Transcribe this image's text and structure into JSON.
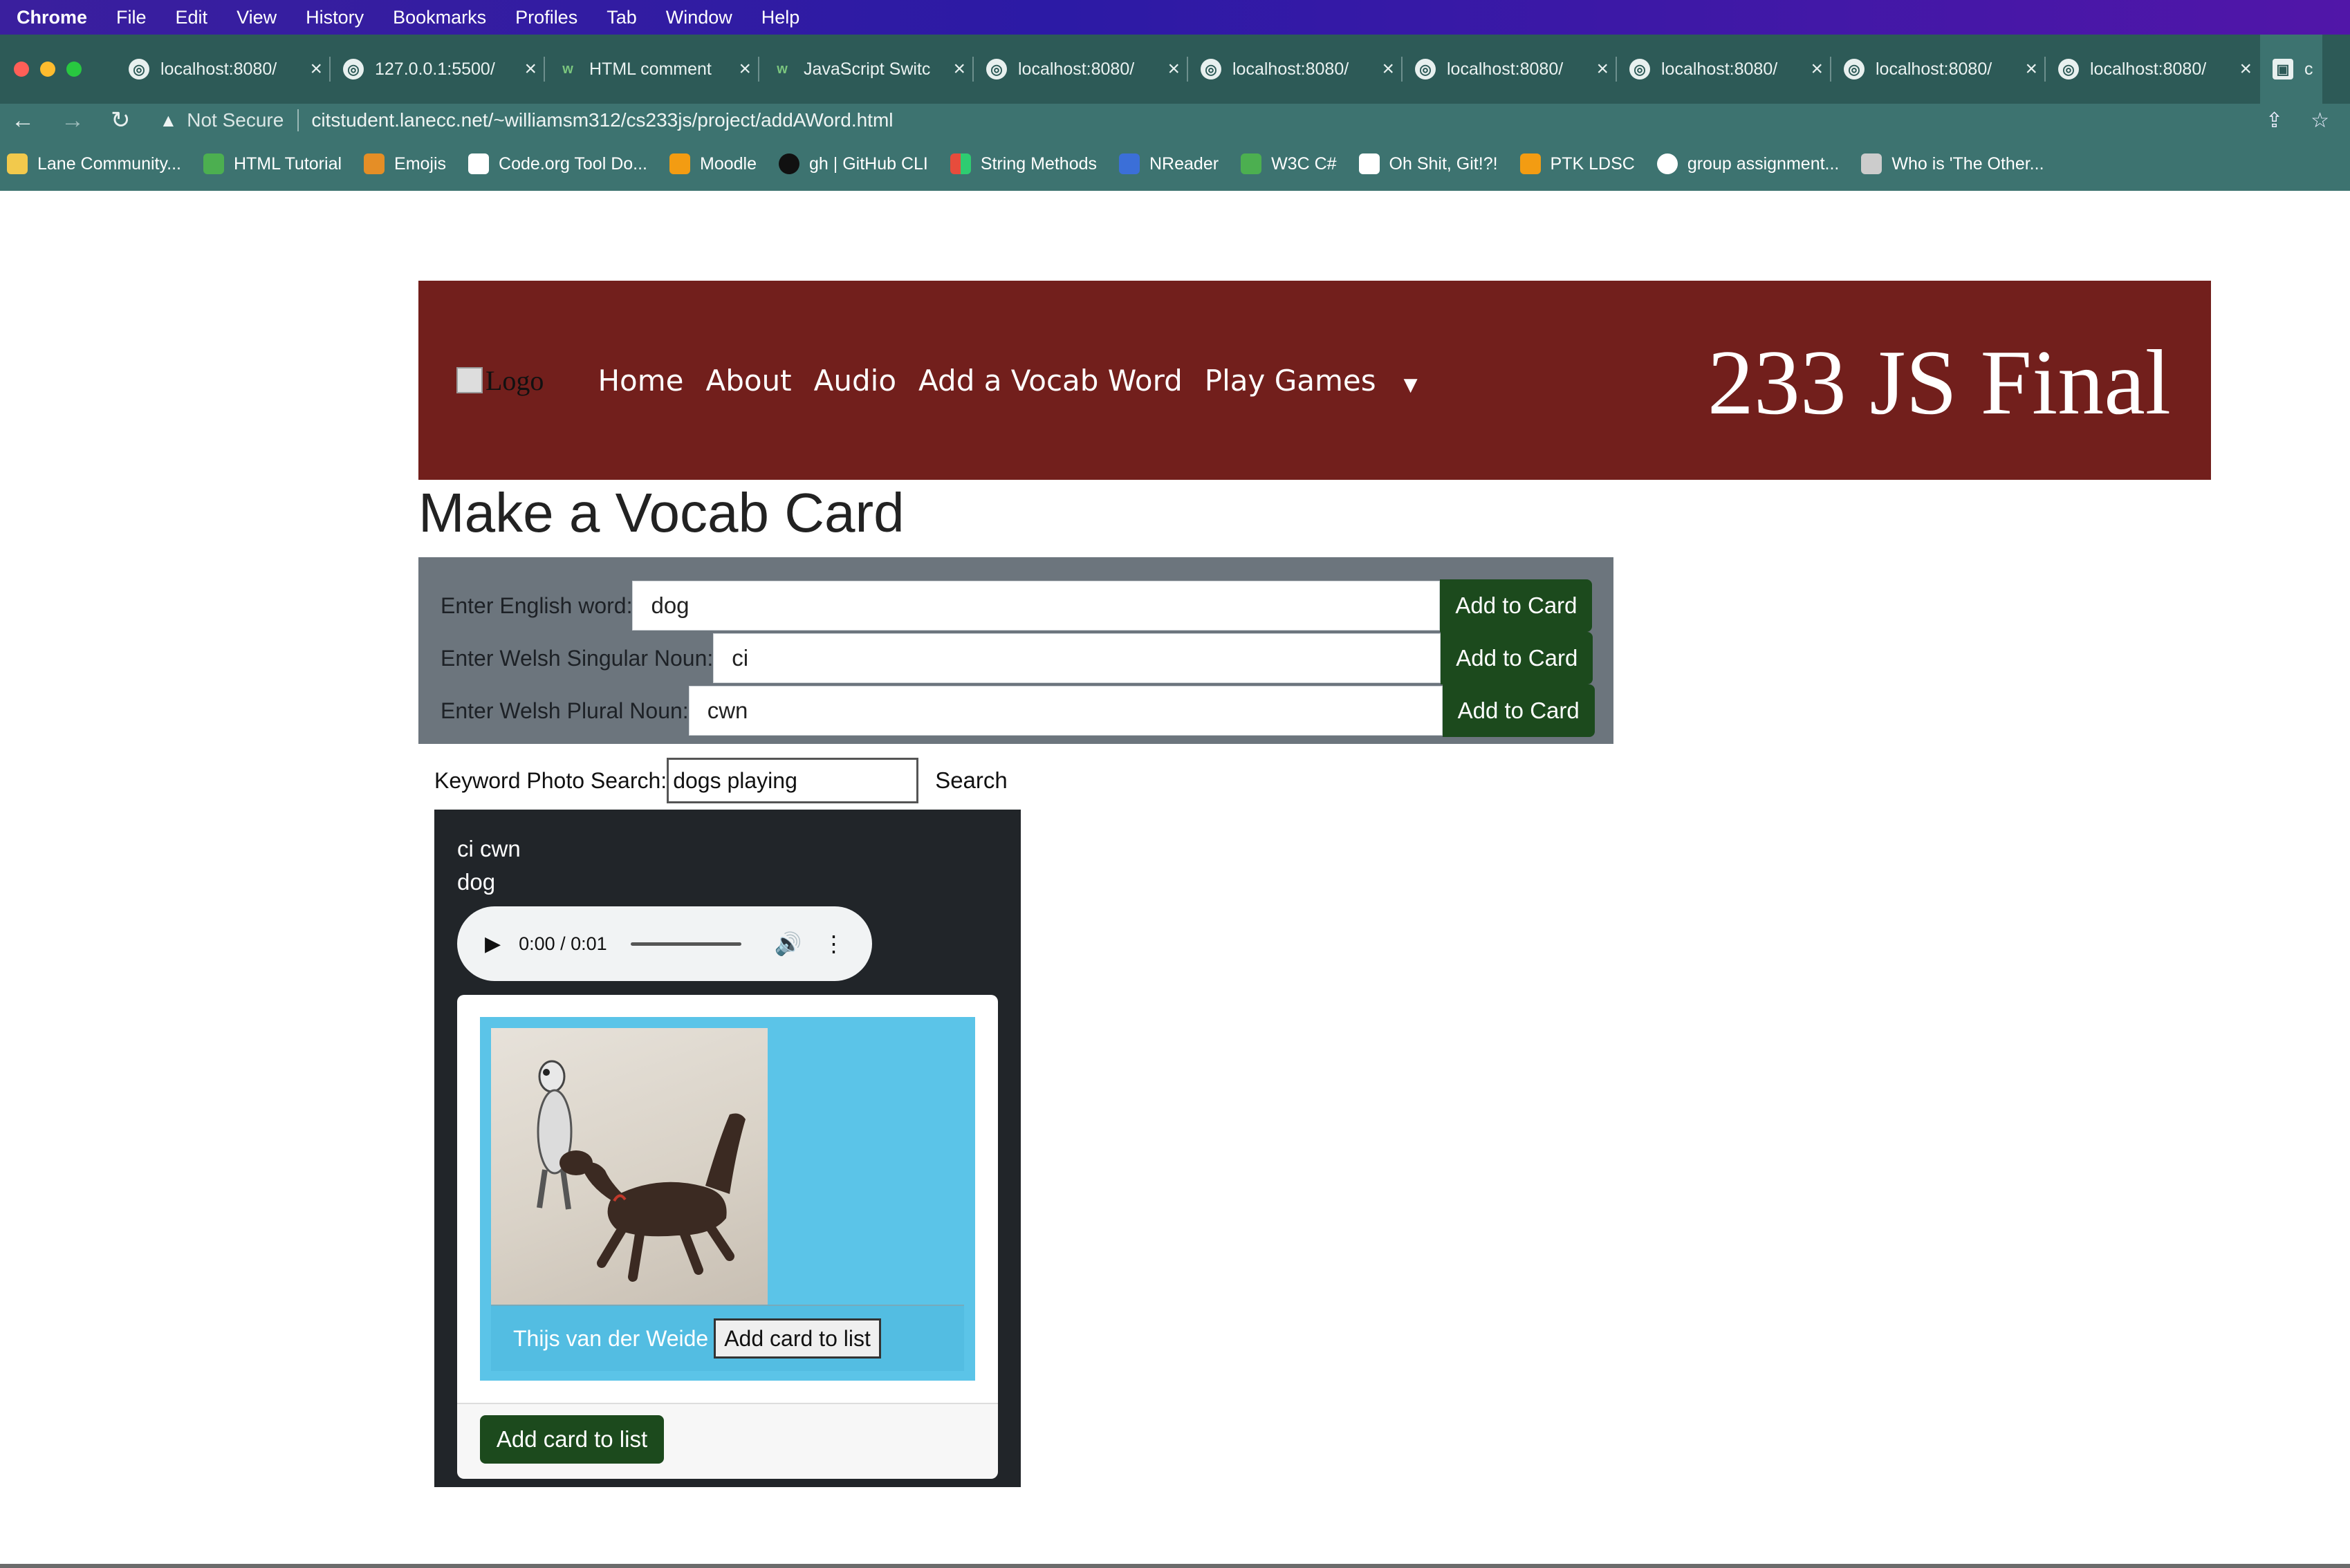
{
  "menubar": {
    "app": "Chrome",
    "items": [
      "File",
      "Edit",
      "View",
      "History",
      "Bookmarks",
      "Profiles",
      "Tab",
      "Window",
      "Help"
    ]
  },
  "tabs": [
    {
      "label": "localhost:8080/"
    },
    {
      "label": "127.0.0.1:5500/"
    },
    {
      "label": "HTML comment"
    },
    {
      "label": "JavaScript Switc"
    },
    {
      "label": "localhost:8080/"
    },
    {
      "label": "localhost:8080/"
    },
    {
      "label": "localhost:8080/"
    },
    {
      "label": "localhost:8080/"
    },
    {
      "label": "localhost:8080/"
    },
    {
      "label": "localhost:8080/"
    },
    {
      "label": "citstu"
    }
  ],
  "address": {
    "security": "Not Secure",
    "url": "citstudent.lanecc.net/~williamsm312/cs233js/project/addAWord.html"
  },
  "bookmarks": [
    {
      "label": "Lane Community...",
      "color": "#f2c94c"
    },
    {
      "label": "HTML Tutorial",
      "color": "#4caf50"
    },
    {
      "label": "Emojis",
      "color": "#e58e26"
    },
    {
      "label": "Code.org Tool Do...",
      "color": "#ffffff"
    },
    {
      "label": "Moodle",
      "color": "#f39c12"
    },
    {
      "label": "gh | GitHub CLI",
      "color": "#111111"
    },
    {
      "label": "String Methods",
      "color": "#e74c3c"
    },
    {
      "label": "NReader",
      "color": "#3b6fd8"
    },
    {
      "label": "W3C C#",
      "color": "#4caf50"
    },
    {
      "label": "Oh Shit, Git!?!",
      "color": "#ffffff"
    },
    {
      "label": "PTK LDSC",
      "color": "#f39c12"
    },
    {
      "label": "group assignment...",
      "color": "#ffffff"
    },
    {
      "label": "Who is 'The Other...",
      "color": "#cccccc"
    }
  ],
  "site": {
    "logo_alt": "Logo",
    "nav": [
      "Home",
      "About",
      "Audio",
      "Add a Vocab Word",
      "Play Games"
    ],
    "title": "233 JS Final"
  },
  "heading": "Make a Vocab Card",
  "form": {
    "english_label": "Enter English word:",
    "english_value": "dog",
    "singular_label": "Enter Welsh Singular Noun:",
    "singular_value": "ci",
    "plural_label": "Enter Welsh Plural Noun:",
    "plural_value": "cwn",
    "add_button": "Add to Card"
  },
  "photo_search": {
    "label": "Keyword Photo Search:",
    "value": "dogs playing",
    "button": "Search"
  },
  "card": {
    "welsh": "ci cwn",
    "english": "dog",
    "audio_time": "0:00 / 0:01",
    "photographer": "Thijs van der Weide",
    "add_small": "Add card to list",
    "add_big": "Add card to list"
  },
  "colors": {
    "header_bg": "#721f1c",
    "form_bg": "#6c757d",
    "button_green": "#1c4a1d",
    "card_dark": "#212529",
    "photo_bg": "#5bc4e8"
  }
}
